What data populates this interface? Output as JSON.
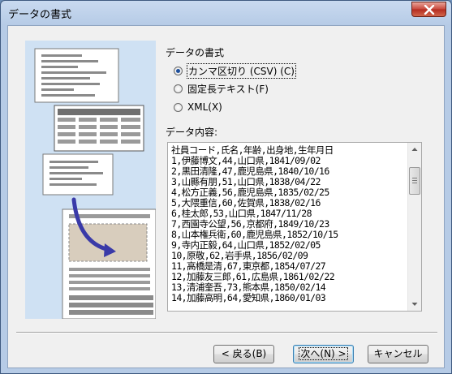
{
  "window": {
    "title": "データの書式"
  },
  "format_group": {
    "label": "データの書式",
    "options": [
      {
        "label": "カンマ区切り (CSV) (C)",
        "checked": true
      },
      {
        "label": "固定長テキスト(F)",
        "checked": false
      },
      {
        "label": "XML(X)",
        "checked": false
      }
    ]
  },
  "content": {
    "label": "データ内容:",
    "lines": [
      "社員コード,氏名,年齢,出身地,生年月日",
      "1,伊藤博文,44,山口県,1841/09/02",
      "2,黒田清隆,47,鹿児島県,1840/10/16",
      "3,山縣有朋,51,山口県,1838/04/22",
      "4,松方正義,56,鹿児島県,1835/02/25",
      "5,大隈重信,60,佐賀県,1838/02/16",
      "6,桂太郎,53,山口県,1847/11/28",
      "7,西園寺公望,56,京都府,1849/10/23",
      "8,山本権兵衛,60,鹿児島県,1852/10/15",
      "9,寺内正毅,64,山口県,1852/02/05",
      "10,原敬,62,岩手県,1856/02/09",
      "11,高橋是清,67,東京都,1854/07/27",
      "12,加藤友三郎,61,広島県,1861/02/22",
      "13,清浦奎吾,73,熊本県,1850/02/14",
      "14,加藤高明,64,愛知県,1860/01/03"
    ]
  },
  "buttons": {
    "back": "< 戻る(B)",
    "next": "次へ(N) >",
    "cancel": "キャンセル"
  },
  "colors": {
    "illustration_bg": "#cfe1f3",
    "arrow": "#3a3aa8"
  }
}
